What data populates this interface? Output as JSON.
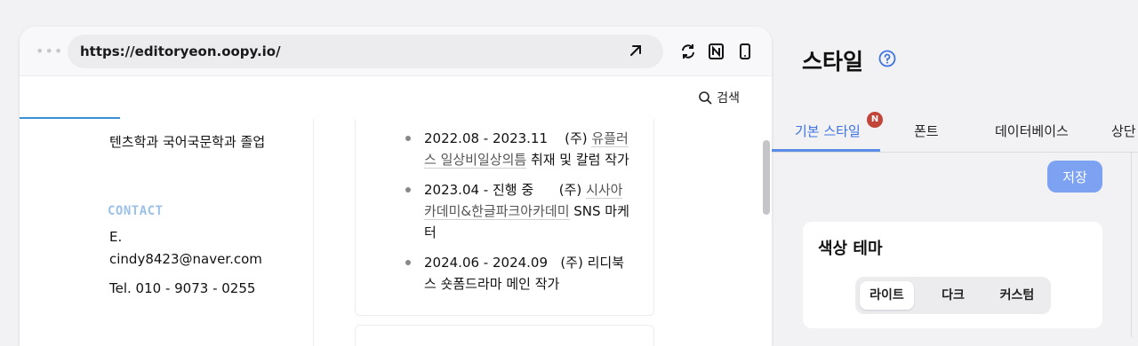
{
  "browser": {
    "url": "https://editoryeon.oopy.io/",
    "search_label": "검색"
  },
  "profile": {
    "education_text": "텐츠학과 국어국문학과 졸업",
    "contact_heading": "CONTACT",
    "email_label": "E.",
    "email": "cindy8423@naver.com",
    "tel": "Tel. 010 - 9073 - 0255"
  },
  "career": [
    {
      "line1_a": "2022.08 - 2023.11",
      "line1_b": "(주)",
      "line1_c": "유플러",
      "line2_a": "스 일상비일상의틈",
      "line2_b": " 취재 및 칼럼 작가"
    },
    {
      "line1_a": "2023.04 - 진행 중",
      "line1_b": "(주)",
      "line1_c": "시사아",
      "line2_a": "카데미&한글파크아카데미",
      "line2_b": " SNS 마케",
      "line3": "터"
    },
    {
      "line1_a": "2024.06 - 2024.09",
      "line1_b": "(주)",
      "line1_c": "리디북",
      "line2_b": "스 숏폼드라마 메인 작가"
    }
  ],
  "settings": {
    "title": "스타일",
    "tabs": [
      "기본 스타일",
      "폰트",
      "데이터베이스",
      "상단"
    ],
    "badge": "N",
    "save_label": "저장",
    "color_theme": {
      "title": "색상 테마",
      "options": [
        "라이트",
        "다크",
        "커스텀"
      ],
      "selected": "라이트"
    }
  },
  "colors": {
    "accent": "#5b8de6",
    "save_button": "#7ea2f2",
    "badge": "#c2453a",
    "contact_heading": "#9cc1e8"
  },
  "icons": [
    "more-dots-icon",
    "open-external-icon",
    "refresh-icon",
    "notion-icon",
    "mobile-icon",
    "search-icon",
    "help-icon"
  ]
}
